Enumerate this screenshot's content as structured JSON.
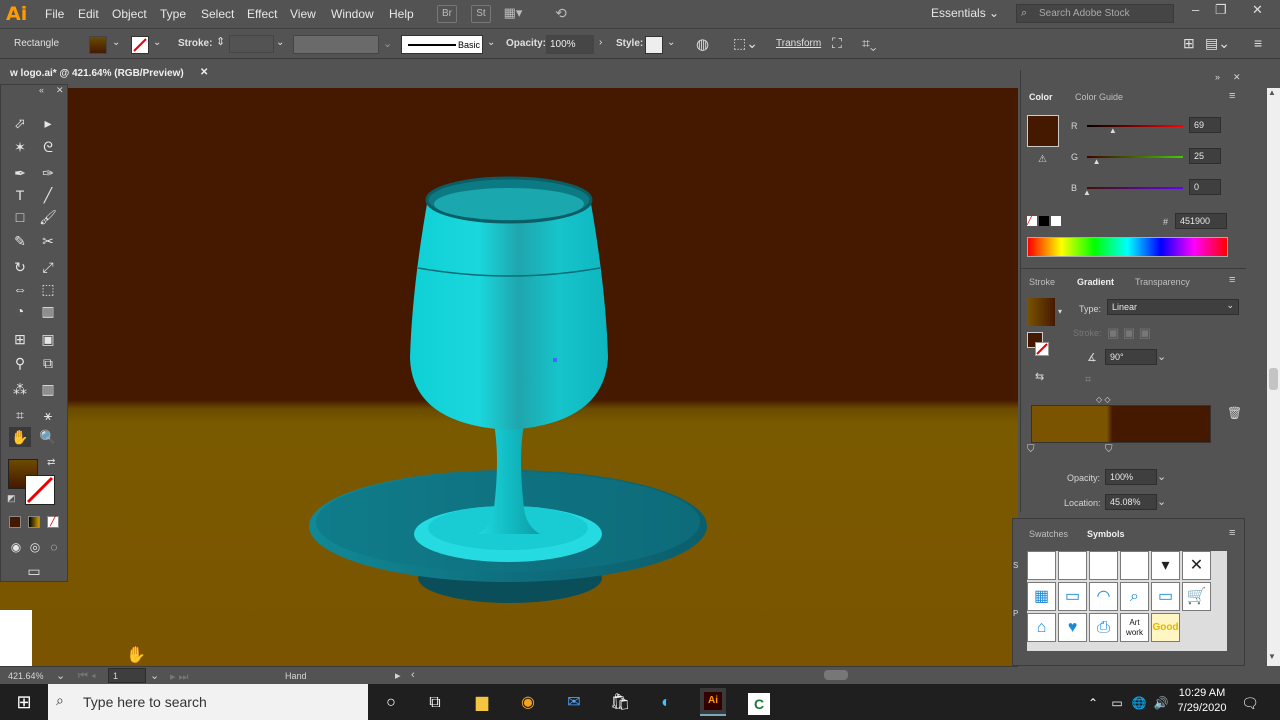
{
  "app": {
    "logo": "Ai"
  },
  "menu": [
    "File",
    "Edit",
    "Object",
    "Type",
    "Select",
    "Effect",
    "View",
    "Window",
    "Help"
  ],
  "menubar_icons": {
    "br": "Br",
    "st": "St"
  },
  "workspace": "Essentials",
  "stock_search": {
    "placeholder": "Search Adobe Stock"
  },
  "control_bar": {
    "tool_name": "Rectangle",
    "stroke_label": "Stroke:",
    "brush": "Basic",
    "opacity_label": "Opacity:",
    "opacity": "100%",
    "style_label": "Style:",
    "transform": "Transform"
  },
  "document": {
    "tab_title": "w logo.ai* @ 421.64% (RGB/Preview)"
  },
  "status": {
    "zoom": "421.64%",
    "artboard": "1",
    "tool": "Hand"
  },
  "color_panel": {
    "tabs": [
      "Color",
      "Color Guide"
    ],
    "r_label": "R",
    "g_label": "G",
    "b_label": "B",
    "r": "69",
    "g": "25",
    "b": "0",
    "r_level": 0.27,
    "g_level": 0.1,
    "b_level": 0.0,
    "hex_label": "#",
    "hex": "451900",
    "swatch_color": "#451900"
  },
  "gradient_panel": {
    "tabs": [
      "Stroke",
      "Gradient",
      "Transparency"
    ],
    "type_label": "Type:",
    "type": "Linear",
    "stroke_label": "Stroke:",
    "angle": "90°",
    "opacity_label": "Opacity:",
    "opacity": "100%",
    "location_label": "Location:",
    "location": "45.08%",
    "stop_colors": [
      "#7a5400",
      "#451900"
    ]
  },
  "symbols_panel": {
    "tabs": [
      "Swatches",
      "Symbols"
    ],
    "row1": [
      "",
      "",
      "",
      "",
      "▾",
      "✕"
    ],
    "row2": [
      "▦",
      "▭",
      "◠",
      "⌕",
      "▭",
      "🛒"
    ],
    "row3": [
      "⌂",
      "♥",
      "⎙",
      "Art work",
      "Good"
    ]
  },
  "taskbar": {
    "search_placeholder": "Type here to search",
    "time": "10:29 AM",
    "date": "7/29/2020"
  },
  "colors": {
    "accent_cyan": "#19d6dc",
    "wall": "#451900",
    "table": "#7a5400"
  }
}
